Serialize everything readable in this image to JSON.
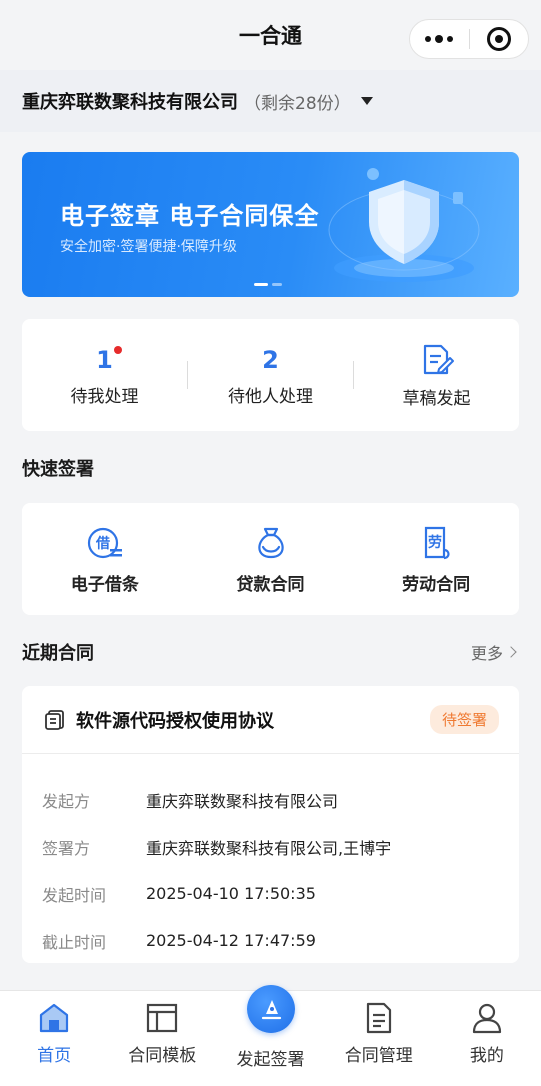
{
  "nav": {
    "title": "一合通"
  },
  "company": {
    "name": "重庆弈联数聚科技有限公司",
    "remain": "（剩余28份）"
  },
  "banner": {
    "title": "电子签章 电子合同保全",
    "subtitle": "安全加密·签署便捷·保障升级"
  },
  "status": {
    "pending_me": {
      "count": "1",
      "label": "待我处理"
    },
    "pending_others": {
      "count": "2",
      "label": "待他人处理"
    },
    "draft": {
      "label": "草稿发起"
    }
  },
  "quick": {
    "title": "快速签署",
    "items": [
      {
        "icon_text": "借",
        "label": "电子借条"
      },
      {
        "label": "贷款合同"
      },
      {
        "icon_text": "劳",
        "label": "劳动合同"
      }
    ]
  },
  "recent": {
    "title": "近期合同",
    "more": "更多",
    "contract": {
      "title": "软件源代码授权使用协议",
      "status": "待签署",
      "rows": [
        {
          "label": "发起方",
          "value": "重庆弈联数聚科技有限公司"
        },
        {
          "label": "签署方",
          "value": "重庆弈联数聚科技有限公司,王博宇"
        },
        {
          "label": "发起时间",
          "value": "2025-04-10 17:50:35"
        },
        {
          "label": "截止时间",
          "value": "2025-04-12 17:47:59"
        }
      ]
    }
  },
  "tabs": [
    {
      "label": "首页"
    },
    {
      "label": "合同模板"
    },
    {
      "label": "发起签署"
    },
    {
      "label": "合同管理"
    },
    {
      "label": "我的"
    }
  ],
  "colors": {
    "primary": "#2f74e6",
    "badge_text": "#ef7a32",
    "badge_bg": "#fdebdd",
    "red_dot": "#e62b2b"
  }
}
